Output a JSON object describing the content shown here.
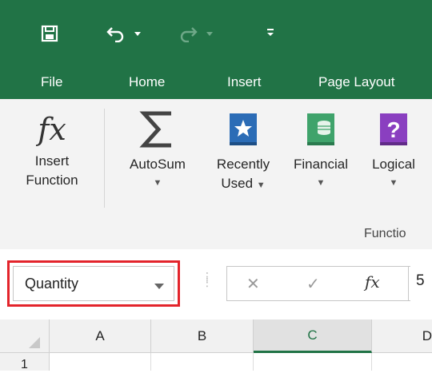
{
  "quick_access": {
    "icons": [
      "save-icon",
      "undo-icon",
      "undo-dropdown-icon",
      "redo-icon",
      "redo-dropdown-icon",
      "customize-toolbar-icon"
    ]
  },
  "tabs": [
    {
      "label": "File"
    },
    {
      "label": "Home"
    },
    {
      "label": "Insert"
    },
    {
      "label": "Page Layout"
    }
  ],
  "ribbon": {
    "insert_function": {
      "line1": "Insert",
      "line2": "Function",
      "icon": "fx-icon"
    },
    "autosum": {
      "label": "AutoSum",
      "icon": "sigma-icon"
    },
    "recently_used": {
      "line1": "Recently",
      "line2": "Used",
      "icon": "star-book-icon"
    },
    "financial": {
      "label": "Financial",
      "icon": "coins-book-icon"
    },
    "logical": {
      "label": "Logical",
      "icon": "question-book-icon"
    },
    "group_label": "Functio",
    "colors": {
      "recently_used": "#2b6cb6",
      "financial": "#3fa36b",
      "logical": "#8a3fc0"
    }
  },
  "formula_bar": {
    "name_box": "Quantity",
    "cancel_glyph": "✕",
    "enter_glyph": "✓",
    "fx_glyph": "fx",
    "value": "5"
  },
  "grid": {
    "columns": [
      "A",
      "B",
      "C",
      "D"
    ],
    "selected_column": "C",
    "rows": [
      "1"
    ]
  },
  "colors": {
    "accent": "#217346",
    "highlight": "#e3242b"
  }
}
